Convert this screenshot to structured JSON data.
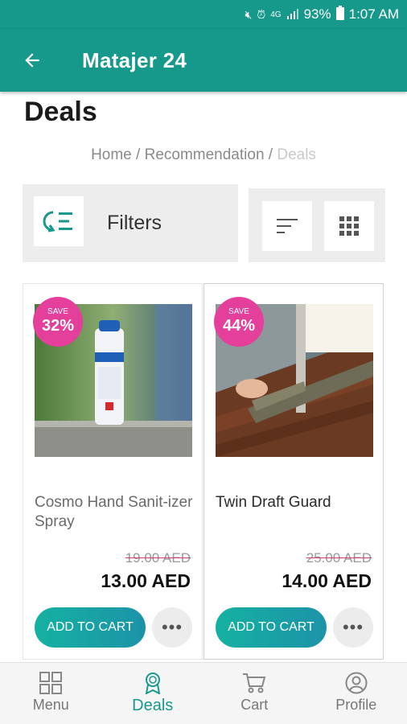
{
  "status_bar": {
    "battery_pct": "93%",
    "time": "1:07 AM",
    "network": "4G"
  },
  "app_bar": {
    "title": "Matajer 24",
    "color": "#16998b"
  },
  "page": {
    "title": "Deals",
    "breadcrumb": {
      "home": "Home",
      "sep1": " / ",
      "recommendation": "Recommendation",
      "sep2": " / ",
      "current": "Deals"
    }
  },
  "toolbar": {
    "filters_label": "Filters"
  },
  "products": [
    {
      "save_label": "SAVE",
      "save_pct": "32%",
      "name": "Cosmo Hand Sanit-izer Spray",
      "old_price": "19.00 AED",
      "new_price": "13.00 AED",
      "cart_label": "ADD TO CART",
      "more_label": "•••"
    },
    {
      "save_label": "SAVE",
      "save_pct": "44%",
      "name": "Twin Draft Guard",
      "old_price": "25.00 AED",
      "new_price": "14.00 AED",
      "cart_label": "ADD TO CART",
      "more_label": "•••"
    }
  ],
  "bottom_nav": [
    {
      "label": "Menu",
      "icon": "grid-icon"
    },
    {
      "label": "Deals",
      "icon": "deals-badge-icon",
      "active": true
    },
    {
      "label": "Cart",
      "icon": "cart-icon"
    },
    {
      "label": "Profile",
      "icon": "profile-icon"
    }
  ],
  "colors": {
    "accent": "#16998b",
    "save_badge": "#e43f9b",
    "cart_gradient_start": "#16b1a2",
    "cart_gradient_end": "#1c93a8"
  }
}
